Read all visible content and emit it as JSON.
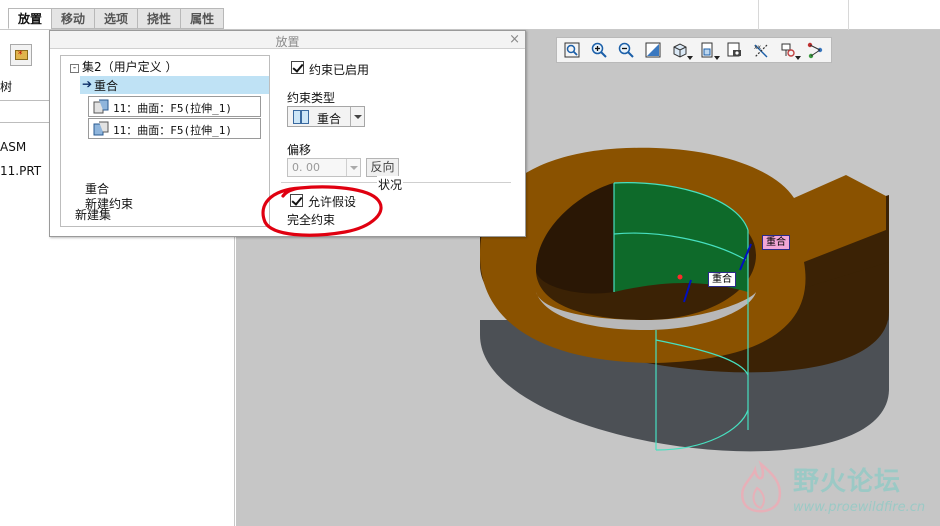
{
  "tabs": [
    {
      "label": "放置",
      "active": true
    },
    {
      "label": "移动",
      "active": false
    },
    {
      "label": "选项",
      "active": false
    },
    {
      "label": "挠性",
      "active": false
    },
    {
      "label": "属性",
      "active": false
    }
  ],
  "left_panel": {
    "label_top": "树",
    "tree_items": [
      "ASM",
      "11.PRT"
    ]
  },
  "dialog": {
    "title": "放置",
    "close_glyph": "×",
    "set_title": "集2（用户定义 ）",
    "set_expander": "-",
    "selected_constraint": "重合",
    "selected_arrow": "➔",
    "references": [
      "11：曲面：F5(拉伸_1)",
      "11：曲面：F5(拉伸_1)"
    ],
    "constraint_name": "重合",
    "new_constraint": "新建约束",
    "new_set": "新建集",
    "constraint_enabled_label": "约束已启用",
    "constraint_enabled": true,
    "constraint_type_label": "约束类型",
    "constraint_type_value": "重合",
    "offset_label": "偏移",
    "offset_value": "0. 00",
    "flip_button": "反向",
    "status_label": "状况",
    "allow_assumptions_label": "允许假设",
    "allow_assumptions": true,
    "status_value": "完全约束"
  },
  "graphics_toolbar": {
    "icons": [
      "refit-icon",
      "zoom-in-icon",
      "zoom-out-icon",
      "repaint-icon",
      "display-style-icon",
      "view-orientation-icon",
      "saved-views-icon",
      "datum-display-icon",
      "spin-center-icon",
      "annotation-display-icon"
    ]
  },
  "model_tags": [
    "重合",
    "重合"
  ],
  "watermark": {
    "title": "野火论坛",
    "url": "www.proewildfire.cn"
  },
  "colors": {
    "model_top": "#8a5200",
    "model_side_upper": "#3b2205",
    "model_side_lower": "#4c5055",
    "highlight_green": "#0e6a2a",
    "viewport_bg": "#c6c6c6",
    "tag_fill_pink": "#f3a6d6",
    "tag_fill_white": "#ffffff",
    "annotation_red": "#e00010"
  }
}
